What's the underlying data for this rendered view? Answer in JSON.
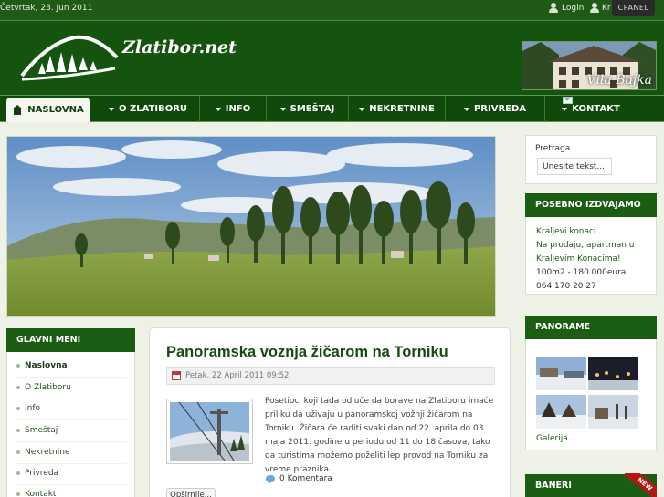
{
  "topbar": {
    "date": "Četvrtak, 23. Jun 2011",
    "login_label": "Login",
    "register_label": "Kr",
    "cpanel_label": "CPANEL"
  },
  "header": {
    "brand": "Zlatibor.net",
    "villa_caption": "Vila Bajka"
  },
  "nav": {
    "items": [
      {
        "label": "NASLOVNA",
        "icon": "home-icon",
        "active": true
      },
      {
        "label": "O ZLATIBORU",
        "dropdown": true
      },
      {
        "label": "INFO",
        "dropdown": true
      },
      {
        "label": "SMEŠTAJ",
        "dropdown": true
      },
      {
        "label": "NEKRETNINE",
        "dropdown": true
      },
      {
        "label": "PRIVREDA",
        "dropdown": true
      },
      {
        "label": "KONTAKT",
        "dropdown": true,
        "icon": "mail-icon"
      }
    ]
  },
  "search": {
    "label": "Pretraga",
    "placeholder": "Unesite tekst..."
  },
  "featured": {
    "title": "POSEBNO IZDVAJAMO",
    "line1": "Kraljevi konaci",
    "line2": "Na prodaju, apartman u",
    "line3": "Kraljevim Konacima!",
    "line4": "100m2 - 180.000eura",
    "line5": "064 170 20 27"
  },
  "panorame": {
    "title": "PANORAME",
    "gallery_link": "Galerija..."
  },
  "baneri": {
    "title": "BANERI",
    "badge": "NEW"
  },
  "left_menu": {
    "title": "GLAVNI MENI",
    "items": [
      {
        "label": "Naslovna",
        "active": true
      },
      {
        "label": "O Zlatiboru"
      },
      {
        "label": "Info"
      },
      {
        "label": "Smeštaj"
      },
      {
        "label": "Nekretnine"
      },
      {
        "label": "Privreda"
      },
      {
        "label": "Kontakt"
      }
    ]
  },
  "article": {
    "title": "Panoramska voznja žičarom na Torniku",
    "date": "Petak, 22 April 2011 09:52",
    "body": "Posetioci koji tada odluče da borave na Zlatiboru imaće priliku da  uživaju u panoramskoj vožnji žičarom na Torniku. Žičara će raditi svaki dan od 22. aprila do 03. maja 2011. godine u periodu od 11 do 18 časova, tako da turistima možemo poželiti lep provod na Torniku za vreme praznika.",
    "comments": "0 Komentara",
    "more_label": "Opširnije..."
  },
  "colors": {
    "header_green": "#14540f",
    "topbar_green": "#1f5a17",
    "title_green": "#174a10"
  }
}
